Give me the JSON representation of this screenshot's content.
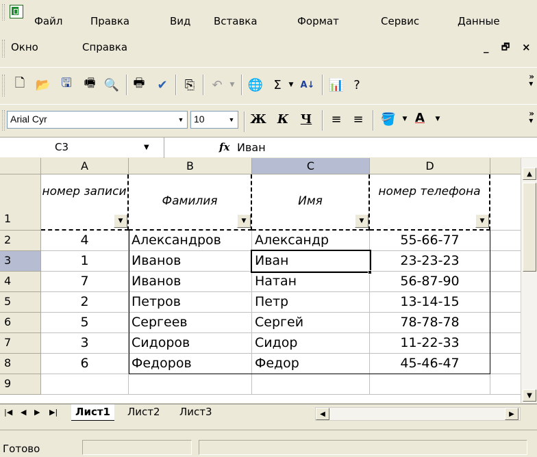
{
  "menu": {
    "items": [
      "Файл",
      "Правка",
      "Вид",
      "Вставка",
      "Формат",
      "Сервис",
      "Данные",
      "Окно",
      "Справка"
    ],
    "window_controls": [
      "_",
      "ŋ",
      "×"
    ]
  },
  "toolbar": {
    "font_name": "Arial Cyr",
    "font_size": "10",
    "bold": "Ж",
    "italic": "К",
    "underline": "Ч",
    "sigma": "Σ"
  },
  "formula_bar": {
    "name_box": "C3",
    "fx": "fx",
    "value": "Иван"
  },
  "sheet": {
    "columns": [
      "A",
      "B",
      "C",
      "D"
    ],
    "row_numbers": [
      "1",
      "2",
      "3",
      "4",
      "5",
      "6",
      "7",
      "8",
      "9"
    ],
    "header_row": [
      "номер записи",
      "Фамилия",
      "Имя",
      "номер телефона"
    ],
    "rows": [
      [
        "4",
        "Александров",
        "Александр",
        "55-66-77"
      ],
      [
        "1",
        "Иванов",
        "Иван",
        "23-23-23"
      ],
      [
        "7",
        "Иванов",
        "Натан",
        "56-87-90"
      ],
      [
        "2",
        "Петров",
        "Петр",
        "13-14-15"
      ],
      [
        "5",
        "Сергеев",
        "Сергей",
        "78-78-78"
      ],
      [
        "3",
        "Сидоров",
        "Сидор",
        "11-22-33"
      ],
      [
        "6",
        "Федоров",
        "Федор",
        "45-46-47"
      ]
    ],
    "active_cell": "C3"
  },
  "tabs": [
    "Лист1",
    "Лист2",
    "Лист3"
  ],
  "active_tab": "Лист1",
  "status": "Готово"
}
